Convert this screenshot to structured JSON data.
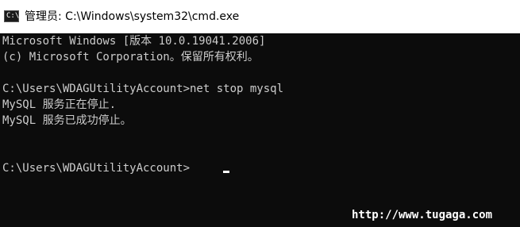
{
  "window": {
    "title": "管理员: C:\\Windows\\system32\\cmd.exe",
    "icon": "cmd-icon",
    "icon_glyph": "C:\\",
    "colors": {
      "titlebar_bg": "#ffffff",
      "console_bg": "#0c0c0c",
      "console_text": "#cccccc"
    }
  },
  "console": {
    "lines": [
      "Microsoft Windows [版本 10.0.19041.2006]",
      "(c) Microsoft Corporation。保留所有权利。",
      "",
      "C:\\Users\\WDAGUtilityAccount>net stop mysql",
      "MySQL 服务正在停止.",
      "MySQL 服务已成功停止。",
      "",
      "",
      "C:\\Users\\WDAGUtilityAccount>"
    ]
  },
  "watermark": "http://www.tugaga.com"
}
